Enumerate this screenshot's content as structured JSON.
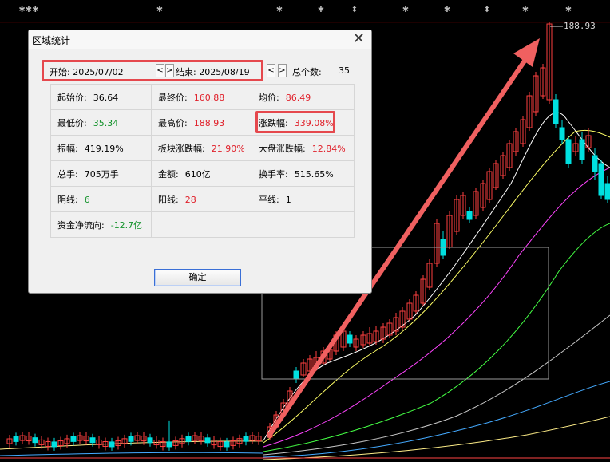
{
  "chart": {
    "max_price_label": "188.93",
    "top_markers": [
      "✱✱✱",
      "✱",
      "✱",
      "✱",
      "⬍",
      "✱",
      "✱",
      "⬍",
      "✱",
      "✱"
    ]
  },
  "dialog": {
    "title": "区域统计",
    "start_label": "开始: 2025/07/02",
    "prev_label": "<",
    "next_label": ">",
    "end_label": "结束: 2025/08/19",
    "prev2_label": "<",
    "next2_label": ">",
    "total_label": "总个数:",
    "total_value": "35",
    "rows": [
      [
        {
          "label": "起始价:",
          "value": "36.64",
          "color": "normal"
        },
        {
          "label": "最终价:",
          "value": "160.88",
          "color": "red"
        },
        {
          "label": "均价:",
          "value": "86.49",
          "color": "red"
        }
      ],
      [
        {
          "label": "最低价:",
          "value": "35.34",
          "color": "green"
        },
        {
          "label": "最高价:",
          "value": "188.93",
          "color": "red"
        },
        {
          "label": "涨跌幅:",
          "value": "339.08%",
          "color": "red"
        }
      ],
      [
        {
          "label": "振幅:",
          "value": "419.19%",
          "color": "normal"
        },
        {
          "label": "板块涨跌幅:",
          "value": "21.90%",
          "color": "red"
        },
        {
          "label": "大盘涨跌幅:",
          "value": "12.84%",
          "color": "red"
        }
      ],
      [
        {
          "label": "总手:",
          "value": "705万手",
          "color": "normal"
        },
        {
          "label": "金额:",
          "value": "610亿",
          "color": "normal"
        },
        {
          "label": "换手率:",
          "value": "515.65%",
          "color": "normal"
        }
      ],
      [
        {
          "label": "阴线:",
          "value": "6",
          "color": "green"
        },
        {
          "label": "阳线:",
          "value": "28",
          "color": "red"
        },
        {
          "label": "平线:",
          "value": "1",
          "color": "normal"
        }
      ],
      [
        {
          "label": "资金净流向:",
          "value": "-12.7亿",
          "color": "green"
        },
        {
          "label": "",
          "value": "",
          "color": "normal"
        },
        {
          "label": "",
          "value": "",
          "color": "normal"
        }
      ]
    ],
    "ok_label": "确定"
  },
  "colors": {
    "up": "#e0202a",
    "down": "#12922a",
    "candle_up": "#ff4040",
    "candle_down": "#00e0e0",
    "highlight": "#e5484d"
  }
}
